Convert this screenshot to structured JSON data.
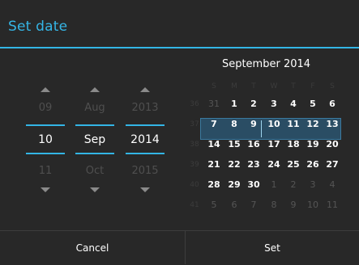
{
  "dialog": {
    "title": "Set date"
  },
  "spinners": [
    {
      "name": "day",
      "prev": "09",
      "current": "10",
      "next": "11"
    },
    {
      "name": "month",
      "prev": "Aug",
      "current": "Sep",
      "next": "Oct"
    },
    {
      "name": "year",
      "prev": "2013",
      "current": "2014",
      "next": "2015"
    }
  ],
  "calendar": {
    "month_title": "September 2014",
    "weekday_headers": [
      "S",
      "M",
      "T",
      "W",
      "T",
      "F",
      "S"
    ],
    "weeks": [
      {
        "week": "36",
        "days": [
          "31",
          "1",
          "2",
          "3",
          "4",
          "5",
          "6"
        ]
      },
      {
        "week": "37",
        "days": [
          "7",
          "8",
          "9",
          "10",
          "11",
          "12",
          "13"
        ]
      },
      {
        "week": "38",
        "days": [
          "14",
          "15",
          "16",
          "17",
          "18",
          "19",
          "20"
        ]
      },
      {
        "week": "39",
        "days": [
          "21",
          "22",
          "23",
          "24",
          "25",
          "26",
          "27"
        ]
      },
      {
        "week": "40",
        "days": [
          "28",
          "29",
          "30",
          "1",
          "2",
          "3",
          "4"
        ]
      },
      {
        "week": "41",
        "days": [
          "5",
          "6",
          "7",
          "8",
          "9",
          "10",
          "11"
        ]
      }
    ]
  },
  "buttons": {
    "cancel": "Cancel",
    "set": "Set"
  },
  "colors": {
    "accent": "#33b5e5",
    "background": "#282828",
    "selected_week": "#2a4d64"
  }
}
